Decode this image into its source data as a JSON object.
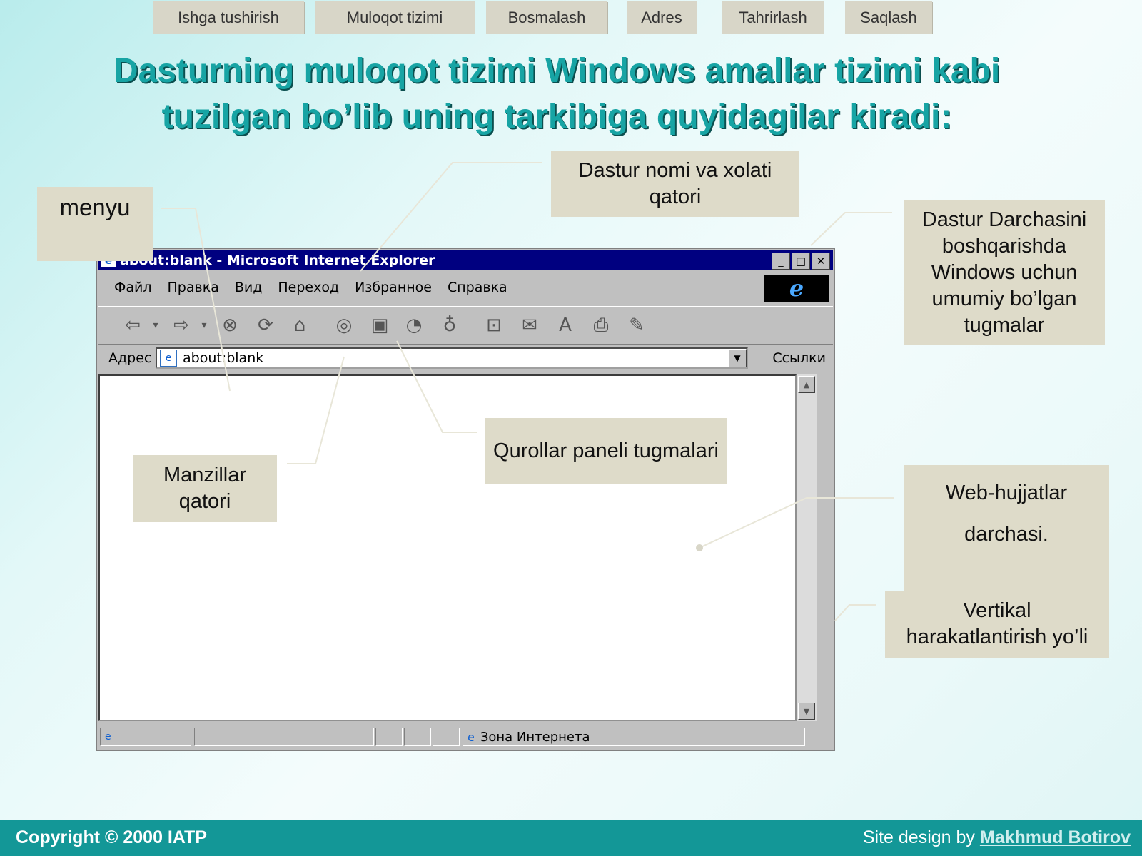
{
  "nav": {
    "items": [
      "Ishga tushirish",
      "Muloqot tizimi",
      "Bosmalash",
      "Adres",
      "Tahrirlash",
      "Saqlash"
    ]
  },
  "slide": {
    "title_line1": "Dasturning muloqot tizimi Windows amallar tizimi kabi",
    "title_line2": "tuzilgan bo’lib uning tarkibiga quyidagilar kiradi:"
  },
  "callouts": {
    "menu": "menyu",
    "title_bar": "Dastur nomi va xolati qatori",
    "window_controls": "Dastur Darchasini boshqarishda Windows uchun umumiy bo’lgan tugmalar",
    "toolbar": "Qurollar paneli tugmalari",
    "address": "Manzillar qatori",
    "web_docs_line1": "Web-hujjatlar",
    "web_docs_line2": "darchasi.",
    "scrollbar": "Vertikal harakatlantirish yo’li"
  },
  "browser": {
    "window_title": "about:blank - Microsoft Internet Explorer",
    "menu": [
      "Файл",
      "Правка",
      "Вид",
      "Переход",
      "Избранное",
      "Справка"
    ],
    "address_label": "Адрес",
    "address_value": "about:blank",
    "links_label": "Ссылки",
    "status_zone": "Зона Интернета",
    "toolbar_icons": [
      "back-icon",
      "forward-icon",
      "stop-icon",
      "refresh-icon",
      "home-icon",
      "search-icon",
      "favorites-icon",
      "history-icon",
      "channels-icon",
      "fullscreen-icon",
      "mail-icon",
      "font-icon",
      "print-icon",
      "edit-icon"
    ]
  },
  "footer": {
    "copyright": "Copyright © 2000 IATP",
    "design_prefix": "Site design by ",
    "designer": "Makhmud Botirov"
  }
}
